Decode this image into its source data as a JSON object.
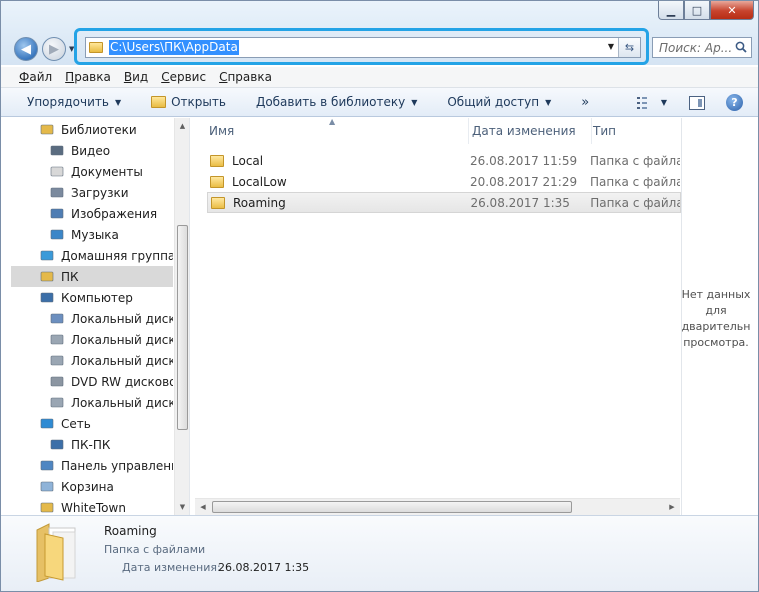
{
  "window": {
    "controls": {
      "minimize": "▁",
      "maximize": "□",
      "close": "✕"
    }
  },
  "address": {
    "path": "C:\\Users\\ПК\\AppData",
    "search_placeholder": "Поиск: Ap..."
  },
  "menu": [
    "Файл",
    "Правка",
    "Вид",
    "Сервис",
    "Справка"
  ],
  "toolbar": {
    "organize": "Упорядочить",
    "open": "Открыть",
    "add_to_library": "Добавить в библиотеку",
    "share": "Общий доступ",
    "more": "»"
  },
  "nav": {
    "items": [
      {
        "label": "Библиотеки",
        "icon": "libraries-icon",
        "level": 0
      },
      {
        "label": "Видео",
        "icon": "video-icon",
        "level": 1
      },
      {
        "label": "Документы",
        "icon": "documents-icon",
        "level": 1
      },
      {
        "label": "Загрузки",
        "icon": "downloads-icon",
        "level": 1
      },
      {
        "label": "Изображения",
        "icon": "pictures-icon",
        "level": 1
      },
      {
        "label": "Музыка",
        "icon": "music-icon",
        "level": 1
      },
      {
        "label": "Домашняя группа",
        "icon": "homegroup-icon",
        "level": 0
      },
      {
        "label": "ПК",
        "icon": "user-folder-icon",
        "level": 0
      },
      {
        "label": "Компьютер",
        "icon": "computer-icon",
        "level": 0
      },
      {
        "label": "Локальный диск (C",
        "icon": "system-drive-icon",
        "level": 1
      },
      {
        "label": "Локальный диск (D",
        "icon": "drive-icon",
        "level": 1
      },
      {
        "label": "Локальный диск (E",
        "icon": "drive-icon",
        "level": 1
      },
      {
        "label": "DVD RW дисковод (",
        "icon": "dvd-drive-icon",
        "level": 1
      },
      {
        "label": "Локальный диск (Y",
        "icon": "drive-icon",
        "level": 1
      },
      {
        "label": "Сеть",
        "icon": "network-icon",
        "level": 0
      },
      {
        "label": "ПК-ПК",
        "icon": "network-computer-icon",
        "level": 1
      },
      {
        "label": "Панель управления",
        "icon": "control-panel-icon",
        "level": 0
      },
      {
        "label": "Корзина",
        "icon": "recycle-bin-icon",
        "level": 0
      },
      {
        "label": "WhiteTown",
        "icon": "folder-icon",
        "level": 0
      }
    ],
    "selected": "ПК"
  },
  "columns": {
    "name": "Имя",
    "date": "Дата изменения",
    "type": "Тип"
  },
  "files": [
    {
      "name": "Local",
      "date": "26.08.2017 11:59",
      "type": "Папка с файлами"
    },
    {
      "name": "LocalLow",
      "date": "20.08.2017 21:29",
      "type": "Папка с файлами"
    },
    {
      "name": "Roaming",
      "date": "26.08.2017 1:35",
      "type": "Папка с файлами"
    }
  ],
  "preview": {
    "lines": [
      "Нет данных",
      "для",
      "дварительн",
      "просмотра."
    ]
  },
  "details": {
    "name": "Roaming",
    "type": "Папка с файлами",
    "date_label": "Дата изменения:",
    "date": "26.08.2017 1:35"
  }
}
